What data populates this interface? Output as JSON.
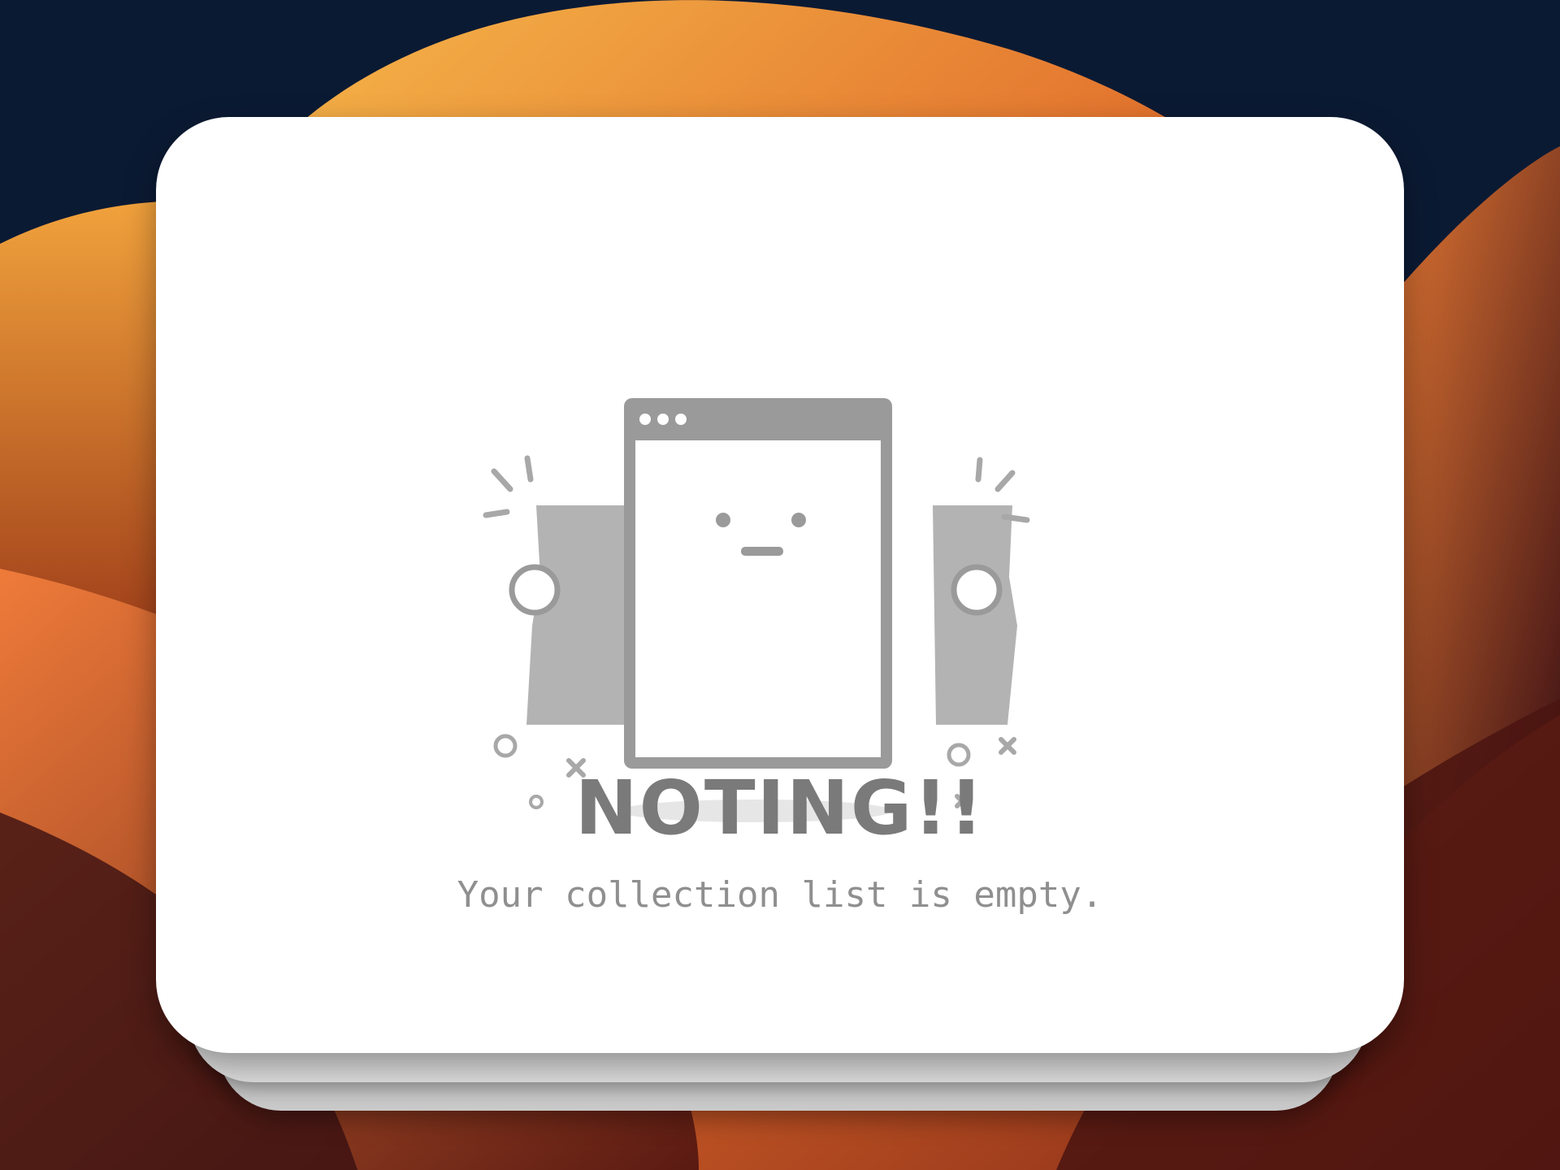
{
  "empty_state": {
    "title": "NOTING!!",
    "message": "Your collection list is empty.",
    "illustration_icon": "empty-browser-window-icon"
  },
  "colors": {
    "card_background": "#ffffff",
    "illustration_gray": "#9a9a9a",
    "title_text": "#7a7a7a",
    "message_text": "#8f8f8f",
    "wallpaper_dark": "#0b1a33",
    "wallpaper_orange": "#e8702a"
  }
}
